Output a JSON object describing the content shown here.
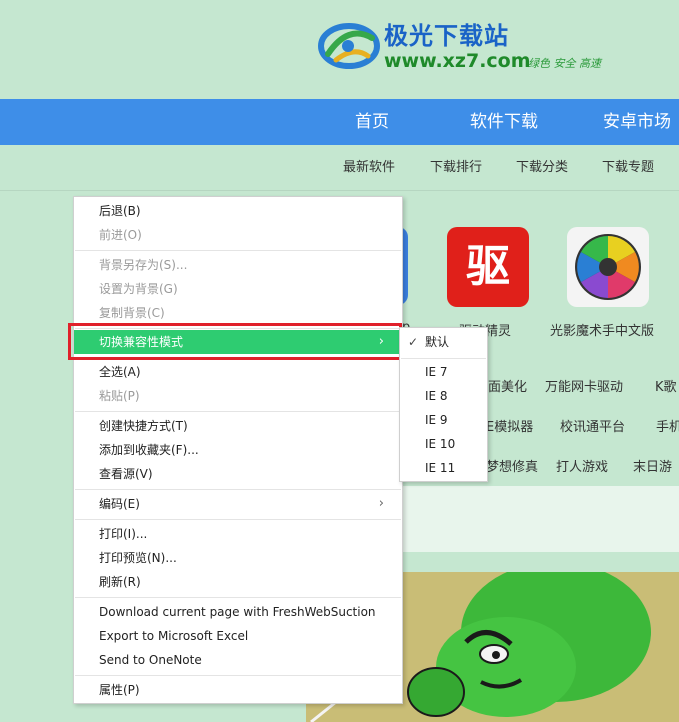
{
  "header": {
    "logo_name": "极光下载站",
    "logo_url": "www.xz7.com",
    "logo_slogan": "绿色 安全 高速"
  },
  "nav": {
    "items": [
      "首页",
      "软件下载",
      "安卓市场"
    ]
  },
  "subnav": {
    "items": [
      "最新软件",
      "下载排行",
      "下载分类",
      "下载专题"
    ]
  },
  "apps": [
    {
      "label": "驱动精灵",
      "icon_text": "驱"
    },
    {
      "label": "光影魔术手中文版"
    }
  ],
  "partial_labels": {
    "app_first": "p"
  },
  "tags": {
    "row1": [
      "面美化",
      "万能网卡驱动",
      "K歌"
    ],
    "row2": [
      "E模拟器",
      "校讯通平台",
      "手机"
    ],
    "row3": [
      "梦想修真",
      "打人游戏",
      "末日游"
    ]
  },
  "context_menu": {
    "items": [
      {
        "label": "后退(B)",
        "disabled": false
      },
      {
        "label": "前进(O)",
        "disabled": true
      },
      {
        "label": "背景另存为(S)...",
        "disabled": true
      },
      {
        "label": "设置为背景(G)",
        "disabled": true
      },
      {
        "label": "复制背景(C)",
        "disabled": true
      },
      {
        "label": "切换兼容性模式",
        "disabled": false,
        "submenu": true,
        "highlighted": true
      },
      {
        "label": "全选(A)",
        "disabled": false
      },
      {
        "label": "粘贴(P)",
        "disabled": true
      },
      {
        "label": "创建快捷方式(T)",
        "disabled": false
      },
      {
        "label": "添加到收藏夹(F)...",
        "disabled": false
      },
      {
        "label": "查看源(V)",
        "disabled": false
      },
      {
        "label": "编码(E)",
        "disabled": false,
        "submenu": true
      },
      {
        "label": "打印(I)...",
        "disabled": false
      },
      {
        "label": "打印预览(N)...",
        "disabled": false
      },
      {
        "label": "刷新(R)",
        "disabled": false
      },
      {
        "label": "Download current page with FreshWebSuction",
        "disabled": false
      },
      {
        "label": "Export to Microsoft Excel",
        "disabled": false
      },
      {
        "label": "Send to OneNote",
        "disabled": false
      },
      {
        "label": "属性(P)",
        "disabled": false
      }
    ],
    "submenu_arrow": "›"
  },
  "compat_submenu": {
    "checked_mark": "✓",
    "items": [
      "默认",
      "IE 7",
      "IE 8",
      "IE 9",
      "IE 10",
      "IE 11"
    ]
  },
  "colors": {
    "page_bg": "#c5e7d0",
    "nav_bg": "#3e8ee8",
    "highlight": "#2ecc71",
    "red_frame": "#e0202a"
  }
}
